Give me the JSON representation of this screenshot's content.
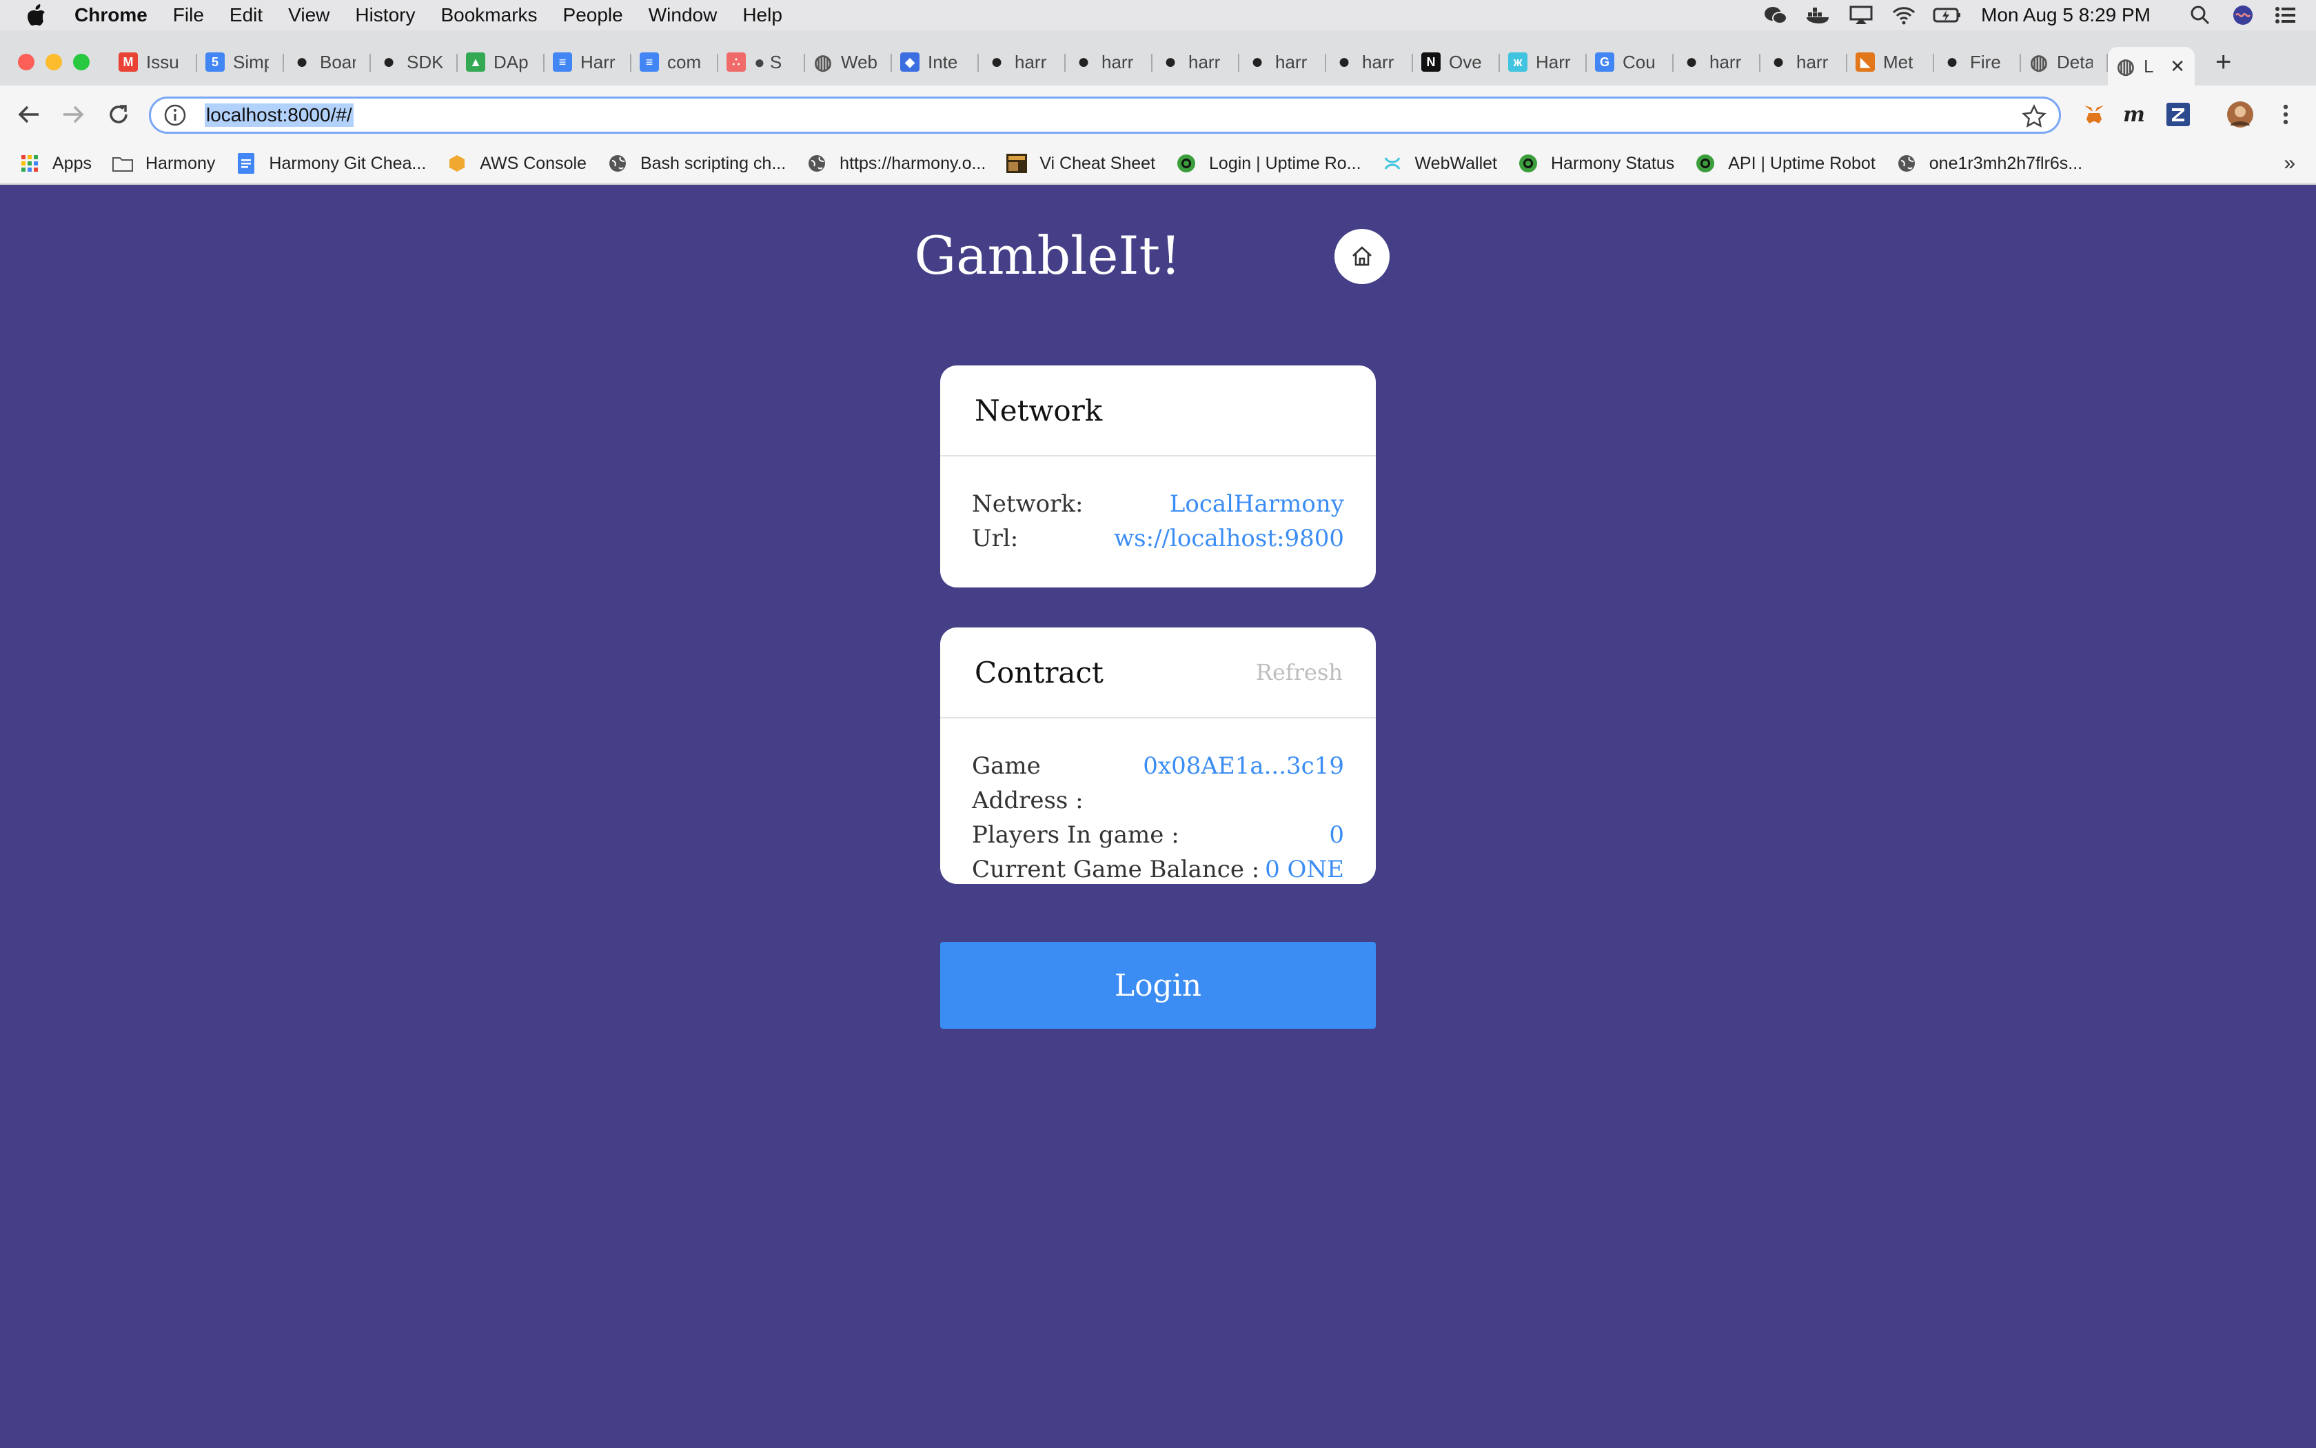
{
  "menubar": {
    "app": "Chrome",
    "items": [
      "File",
      "Edit",
      "View",
      "History",
      "Bookmarks",
      "People",
      "Window",
      "Help"
    ],
    "clock": "Mon Aug 5  8:29 PM"
  },
  "tabs": [
    {
      "title": "Issu",
      "icon": "gmail-icon",
      "color": "#ea4335",
      "glyph": "M"
    },
    {
      "title": "Simp",
      "icon": "calendar-icon",
      "color": "#4285f4",
      "glyph": "5"
    },
    {
      "title": "Boar",
      "icon": "github-icon",
      "color": "#222222",
      "glyph": "●"
    },
    {
      "title": "SDK",
      "icon": "github-icon",
      "color": "#222222",
      "glyph": "●"
    },
    {
      "title": "DAp",
      "icon": "drive-icon",
      "color": "#34a853",
      "glyph": "▲"
    },
    {
      "title": "Harr",
      "icon": "docs-icon",
      "color": "#4285f4",
      "glyph": "≡"
    },
    {
      "title": "com",
      "icon": "docs-icon",
      "color": "#4285f4",
      "glyph": "≡"
    },
    {
      "title": "● S",
      "icon": "asana-icon",
      "color": "#f06a6a",
      "glyph": "∴"
    },
    {
      "title": "Web",
      "icon": "globe-icon",
      "color": "#555555",
      "glyph": "◍"
    },
    {
      "title": "Inte",
      "icon": "course-icon",
      "color": "#3b6ee0",
      "glyph": "◆"
    },
    {
      "title": "harr",
      "icon": "github-icon",
      "color": "#222222",
      "glyph": "●"
    },
    {
      "title": "harr",
      "icon": "github-icon",
      "color": "#222222",
      "glyph": "●"
    },
    {
      "title": "harr",
      "icon": "github-icon",
      "color": "#222222",
      "glyph": "●"
    },
    {
      "title": "harr",
      "icon": "github-icon",
      "color": "#222222",
      "glyph": "●"
    },
    {
      "title": "harr",
      "icon": "github-icon",
      "color": "#222222",
      "glyph": "●"
    },
    {
      "title": "Ove",
      "icon": "notion-icon",
      "color": "#111111",
      "glyph": "N"
    },
    {
      "title": "Harr",
      "icon": "harmony-icon",
      "color": "#40c4e0",
      "glyph": "ж"
    },
    {
      "title": "Cou",
      "icon": "google-icon",
      "color": "#4285f4",
      "glyph": "G"
    },
    {
      "title": "harr",
      "icon": "github-icon",
      "color": "#222222",
      "glyph": "●"
    },
    {
      "title": "harr",
      "icon": "github-icon",
      "color": "#222222",
      "glyph": "●"
    },
    {
      "title": "Met",
      "icon": "metamask-icon",
      "color": "#e2761b",
      "glyph": "◣"
    },
    {
      "title": "Fire",
      "icon": "github-icon",
      "color": "#222222",
      "glyph": "●"
    },
    {
      "title": "Deta",
      "icon": "globe-icon",
      "color": "#555555",
      "glyph": "◍"
    },
    {
      "title": "L",
      "icon": "globe-icon",
      "color": "#555555",
      "glyph": "◍",
      "active": true
    }
  ],
  "omnibox": {
    "url": "localhost:8000/#/"
  },
  "bookmarks": [
    {
      "label": "Apps",
      "icon": "apps-grid-icon"
    },
    {
      "label": "Harmony",
      "icon": "folder-icon"
    },
    {
      "label": "Harmony Git Chea...",
      "icon": "docs-icon"
    },
    {
      "label": "AWS Console",
      "icon": "aws-icon"
    },
    {
      "label": "Bash scripting ch...",
      "icon": "globe-icon"
    },
    {
      "label": "https://harmony.o...",
      "icon": "globe-icon"
    },
    {
      "label": "Vi Cheat Sheet",
      "icon": "vi-icon"
    },
    {
      "label": "Login | Uptime Ro...",
      "icon": "uptime-icon"
    },
    {
      "label": "WebWallet",
      "icon": "harmony-icon"
    },
    {
      "label": "Harmony Status",
      "icon": "uptime-icon"
    },
    {
      "label": "API | Uptime Robot",
      "icon": "uptime-icon"
    },
    {
      "label": "one1r3mh2h7flr6s...",
      "icon": "globe-icon"
    }
  ],
  "bookmarks_more": "»",
  "app": {
    "title": "GambleIt!",
    "network_card": {
      "heading": "Network",
      "rows": [
        {
          "label": "Network:",
          "value": "LocalHarmony"
        },
        {
          "label": "Url:",
          "value": "ws://localhost:9800"
        }
      ]
    },
    "contract_card": {
      "heading": "Contract",
      "refresh": "Refresh",
      "rows": [
        {
          "label": "Game Address :",
          "value": "0x08AE1a...3c19"
        },
        {
          "label": "Players In game :",
          "value": "0"
        },
        {
          "label": "Current Game Balance :",
          "value": "0 ONE"
        }
      ]
    },
    "login_label": "Login"
  },
  "colors": {
    "background": "#443f86",
    "accent": "#3b8df4"
  }
}
